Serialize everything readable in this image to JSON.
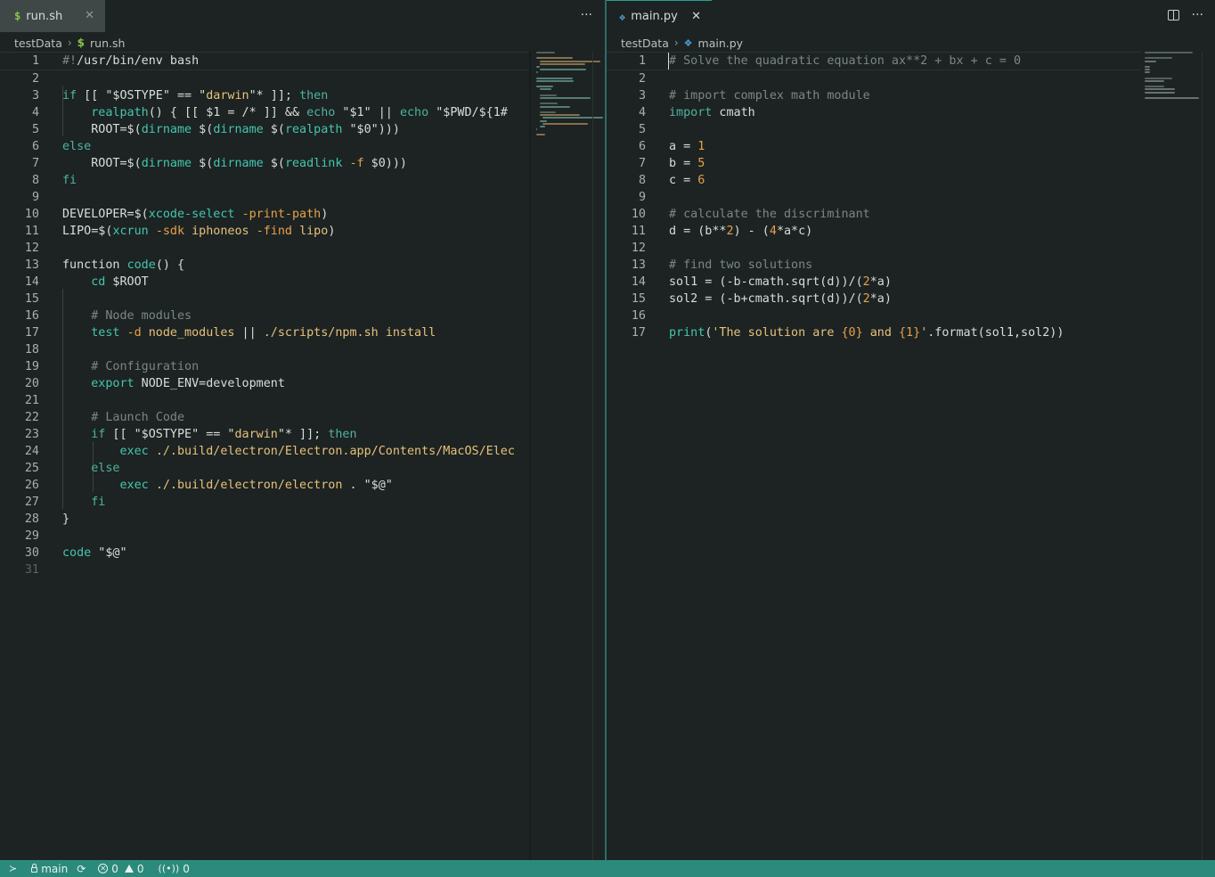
{
  "left": {
    "tab_icon": "$",
    "tab_label": "run.sh",
    "close_icon": "✕",
    "more_icon": "···",
    "breadcrumb": {
      "folder": "testData",
      "file_icon": "$",
      "file": "run.sh"
    },
    "lines": [
      {
        "n": "1",
        "code": "#!/usr/bin/env bash"
      },
      {
        "n": "2",
        "code": ""
      },
      {
        "n": "3",
        "code": "if [[ \"$OSTYPE\" == \"darwin\"* ]]; then"
      },
      {
        "n": "4",
        "code": "    realpath() { [[ $1 = /* ]] && echo \"$1\" || echo \"$PWD/${1#"
      },
      {
        "n": "5",
        "code": "    ROOT=$(dirname $(dirname $(realpath \"$0\")))"
      },
      {
        "n": "6",
        "code": "else"
      },
      {
        "n": "7",
        "code": "    ROOT=$(dirname $(dirname $(readlink -f $0)))"
      },
      {
        "n": "8",
        "code": "fi"
      },
      {
        "n": "9",
        "code": ""
      },
      {
        "n": "10",
        "code": "DEVELOPER=$(xcode-select -print-path)"
      },
      {
        "n": "11",
        "code": "LIPO=$(xcrun -sdk iphoneos -find lipo)"
      },
      {
        "n": "12",
        "code": ""
      },
      {
        "n": "13",
        "code": "function code() {"
      },
      {
        "n": "14",
        "code": "    cd $ROOT"
      },
      {
        "n": "15",
        "code": ""
      },
      {
        "n": "16",
        "code": "    # Node modules"
      },
      {
        "n": "17",
        "code": "    test -d node_modules || ./scripts/npm.sh install"
      },
      {
        "n": "18",
        "code": ""
      },
      {
        "n": "19",
        "code": "    # Configuration"
      },
      {
        "n": "20",
        "code": "    export NODE_ENV=development"
      },
      {
        "n": "21",
        "code": ""
      },
      {
        "n": "22",
        "code": "    # Launch Code"
      },
      {
        "n": "23",
        "code": "    if [[ \"$OSTYPE\" == \"darwin\"* ]]; then"
      },
      {
        "n": "24",
        "code": "        exec ./.build/electron/Electron.app/Contents/MacOS/Elec"
      },
      {
        "n": "25",
        "code": "    else"
      },
      {
        "n": "26",
        "code": "        exec ./.build/electron/electron . \"$@\""
      },
      {
        "n": "27",
        "code": "    fi"
      },
      {
        "n": "28",
        "code": "}"
      },
      {
        "n": "29",
        "code": ""
      },
      {
        "n": "30",
        "code": "code \"$@\""
      },
      {
        "n": "31",
        "code": ""
      }
    ]
  },
  "right": {
    "tab_icon": "py",
    "tab_label": "main.py",
    "close_icon": "✕",
    "more_icon": "···",
    "split_icon": "split-editor-icon",
    "breadcrumb": {
      "folder": "testData",
      "file_icon": "py",
      "file": "main.py"
    },
    "lines": [
      {
        "n": "1",
        "code": "# Solve the quadratic equation ax**2 + bx + c = 0"
      },
      {
        "n": "2",
        "code": ""
      },
      {
        "n": "3",
        "code": "# import complex math module"
      },
      {
        "n": "4",
        "code": "import cmath"
      },
      {
        "n": "5",
        "code": ""
      },
      {
        "n": "6",
        "code": "a = 1"
      },
      {
        "n": "7",
        "code": "b = 5"
      },
      {
        "n": "8",
        "code": "c = 6"
      },
      {
        "n": "9",
        "code": ""
      },
      {
        "n": "10",
        "code": "# calculate the discriminant"
      },
      {
        "n": "11",
        "code": "d = (b**2) - (4*a*c)"
      },
      {
        "n": "12",
        "code": ""
      },
      {
        "n": "13",
        "code": "# find two solutions"
      },
      {
        "n": "14",
        "code": "sol1 = (-b-cmath.sqrt(d))/(2*a)"
      },
      {
        "n": "15",
        "code": "sol2 = (-b+cmath.sqrt(d))/(2*a)"
      },
      {
        "n": "16",
        "code": ""
      },
      {
        "n": "17",
        "code": "print('The solution are {0} and {1}'.format(sol1,sol2))"
      }
    ]
  },
  "status": {
    "remote_icon": "remote-icon",
    "branch": "main",
    "sync_icon": "⟳",
    "errors": "0",
    "warnings": "0",
    "ports": "0"
  },
  "colors": {
    "accent": "#2c8a7c",
    "background": "#1c2322",
    "comment": "#7b8784",
    "keyword": "#4fb3a0",
    "string": "#e8c07c",
    "number": "#e9a04b"
  }
}
